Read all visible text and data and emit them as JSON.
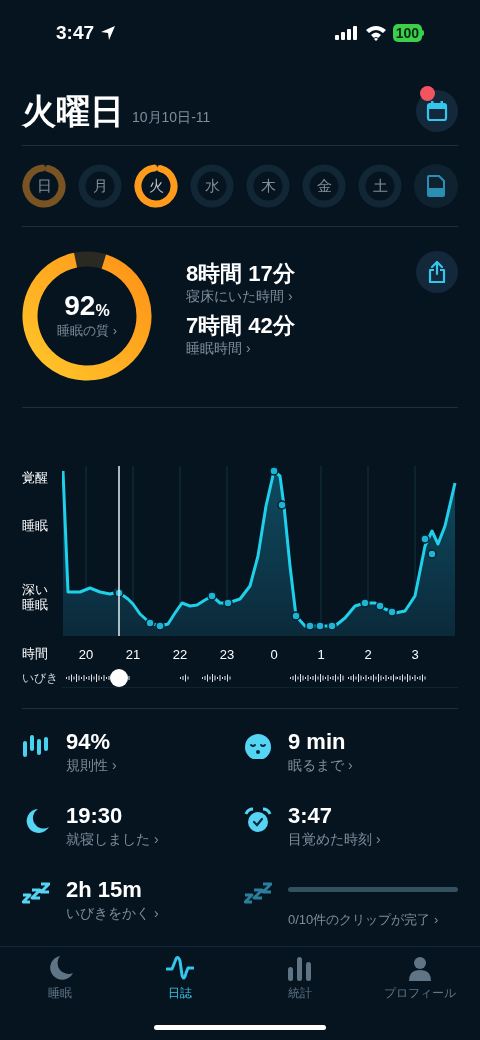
{
  "status_bar": {
    "time": "3:47",
    "battery": "100"
  },
  "header": {
    "title": "火曜日",
    "date": "10月10日-11",
    "calendar_badge": true
  },
  "days": [
    {
      "label": "日",
      "selected": false,
      "has_score": true
    },
    {
      "label": "月",
      "selected": false,
      "has_score": false
    },
    {
      "label": "火",
      "selected": true,
      "has_score": true
    },
    {
      "label": "水",
      "selected": false,
      "has_score": false
    },
    {
      "label": "木",
      "selected": false,
      "has_score": false
    },
    {
      "label": "金",
      "selected": false,
      "has_score": false
    },
    {
      "label": "土",
      "selected": false,
      "has_score": false
    }
  ],
  "summary": {
    "quality": {
      "value": "92",
      "unit": "%",
      "label": "睡眠の質 ›"
    },
    "metrics": [
      {
        "value": "8時間 17分",
        "label": "寝床にいた時間 ›"
      },
      {
        "value": "7時間 42分",
        "label": "睡眠時間 ›"
      }
    ]
  },
  "sleep_graph": {
    "y_labels": [
      "覚醒",
      "睡眠",
      "深い睡眠"
    ],
    "x_label": "時間",
    "x_ticks": [
      "20",
      "21",
      "22",
      "23",
      "0",
      "1",
      "2",
      "3"
    ],
    "snore_label": "いびき"
  },
  "stats": [
    {
      "kind": "regularity",
      "value": "94%",
      "label": "規則性 ›"
    },
    {
      "kind": "sleepy",
      "value": "9 min",
      "label": "眠るまで ›"
    },
    {
      "kind": "moon",
      "value": "19:30",
      "label": "就寝しました ›"
    },
    {
      "kind": "alarm",
      "value": "3:47",
      "label": "目覚めた時刻 ›"
    },
    {
      "kind": "snore",
      "value": "2h 15m",
      "label": "いびきをかく ›"
    },
    {
      "kind": "clips",
      "level": 0,
      "label": "0/10件のクリップが完了 ›"
    }
  ],
  "tabs": [
    {
      "kind": "moon",
      "label": "睡眠",
      "selected": false
    },
    {
      "kind": "wave",
      "label": "日誌",
      "selected": true
    },
    {
      "kind": "bars",
      "label": "統計",
      "selected": false
    },
    {
      "kind": "person",
      "label": "プロフィール",
      "selected": false
    }
  ]
}
